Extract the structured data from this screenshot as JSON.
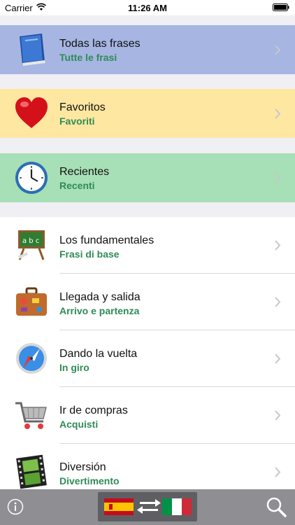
{
  "status_bar": {
    "carrier": "Carrier",
    "time": "11:26 AM"
  },
  "sections": [
    {
      "title": "Todas las frases",
      "subtitle": "Tutte le frasi",
      "icon": "book-icon",
      "color": "#a6b5e2"
    },
    {
      "title": "Favoritos",
      "subtitle": "Favoriti",
      "icon": "heart-icon",
      "color": "#fee7a1"
    },
    {
      "title": "Recientes",
      "subtitle": "Recenti",
      "icon": "clock-icon",
      "color": "#a7dfb6"
    }
  ],
  "categories": [
    {
      "title": "Los fundamentales",
      "subtitle": "Frasi di base",
      "icon": "chalkboard-icon"
    },
    {
      "title": "Llegada y salida",
      "subtitle": "Arrivo e partenza",
      "icon": "suitcase-icon"
    },
    {
      "title": "Dando la vuelta",
      "subtitle": "In giro",
      "icon": "compass-icon"
    },
    {
      "title": "Ir de compras",
      "subtitle": "Acquisti",
      "icon": "shopping-cart-icon"
    },
    {
      "title": "Diversión",
      "subtitle": "Divertimento",
      "icon": "film-icon"
    }
  ],
  "toolbar": {
    "info_icon": "info-icon",
    "language_swap_icon": "language-swap-icon",
    "search_icon": "search-icon"
  },
  "colors": {
    "subtitle": "#2e8b57",
    "toolbar": "#8e8e93",
    "background": "#efeff4"
  }
}
